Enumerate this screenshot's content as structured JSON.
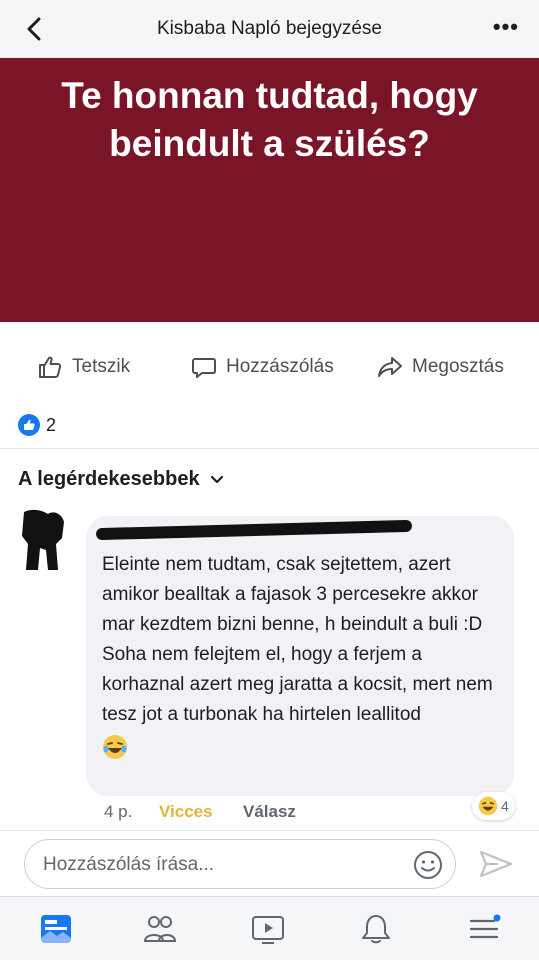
{
  "header": {
    "title": "Kisbaba Napló bejegyzése",
    "more": "•••"
  },
  "post": {
    "banner_text": "Te honnan tudtad, hogy beindult a szülés?",
    "banner_color": "#7a1528"
  },
  "actions": {
    "like": "Tetszik",
    "comment": "Hozzászólás",
    "share": "Megosztás"
  },
  "reactions": {
    "count": "2"
  },
  "comments": {
    "sort_label": "A legérdekesebbek",
    "items": [
      {
        "text": "Eleinte nem tudtam, csak sejtettem, azert amikor bealltak a fajasok 3 percesekre akkor mar kezdtem bizni benne, h beindult a buli :D Soha nem felejtem el, hogy a ferjem a korhaznal azert meg jaratta a kocsit, mert nem tesz jot a turbonak ha hirtelen leallitod",
        "emoji": "laughing-face",
        "time": "4 p.",
        "reaction_label": "Vicces",
        "reply_label": "Válasz",
        "reaction_count": "4"
      }
    ]
  },
  "composer": {
    "placeholder": "Hozzászólás írása..."
  },
  "colors": {
    "accent": "#1877f2",
    "funny": "#e5b33c"
  }
}
